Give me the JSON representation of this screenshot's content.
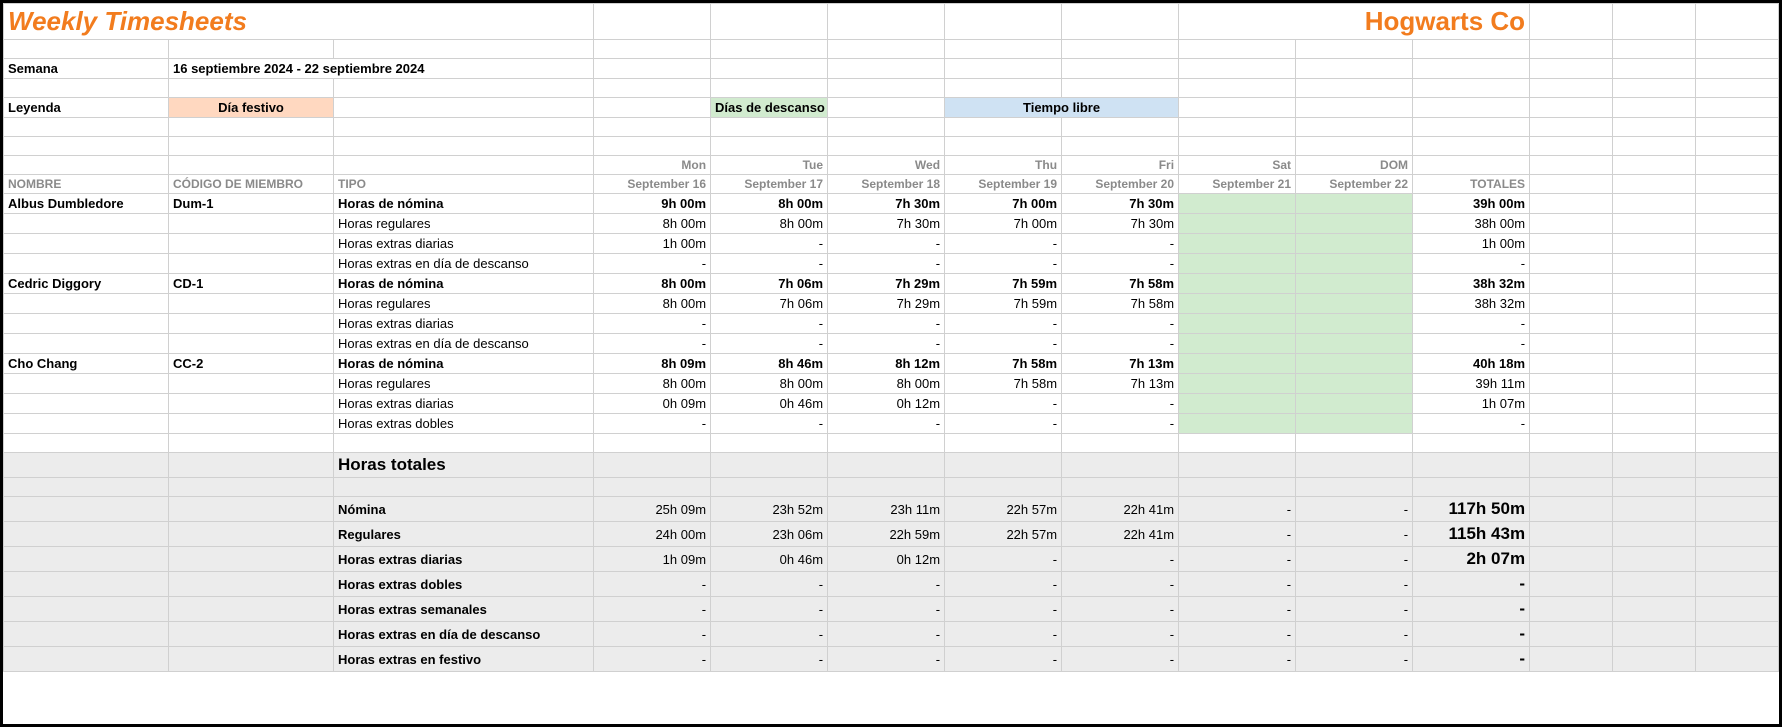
{
  "title": "Weekly Timesheets",
  "company": "Hogwarts Co",
  "meta": {
    "semana_label": "Semana",
    "semana_value": "16 septiembre 2024 - 22 septiembre 2024",
    "leyenda_label": "Leyenda",
    "dia_festivo": "Día festivo",
    "dias_descanso": "Días de descanso",
    "tiempo_libre": "Tiempo libre"
  },
  "headers": {
    "nombre": "NOMBRE",
    "codigo": "CÓDIGO DE MIEMBRO",
    "tipo": "TIPO",
    "totales": "TOTALES",
    "days_top": [
      "Mon",
      "Tue",
      "Wed",
      "Thu",
      "Fri",
      "Sat",
      "DOM"
    ],
    "days_bottom": [
      "September 16",
      "September 17",
      "September 18",
      "September 19",
      "September 20",
      "September 21",
      "September 22"
    ]
  },
  "employees": [
    {
      "name": "Albus Dumbledore",
      "code": "Dum-1",
      "rows": [
        {
          "label": "Horas de nómina",
          "bold": true,
          "vals": [
            "9h 00m",
            "8h 00m",
            "7h 30m",
            "7h 00m",
            "7h 30m",
            "",
            ""
          ],
          "total": "39h 00m",
          "greenWeekend": true
        },
        {
          "label": "Horas regulares",
          "bold": false,
          "vals": [
            "8h 00m",
            "8h 00m",
            "7h 30m",
            "7h 00m",
            "7h 30m",
            "",
            ""
          ],
          "total": "38h 00m",
          "greenWeekend": true
        },
        {
          "label": "Horas extras diarias",
          "bold": false,
          "vals": [
            "1h 00m",
            "-",
            "-",
            "-",
            "-",
            "",
            ""
          ],
          "total": "1h 00m",
          "greenWeekend": true
        },
        {
          "label": "Horas extras en día de descanso",
          "bold": false,
          "vals": [
            "-",
            "-",
            "-",
            "-",
            "-",
            "",
            ""
          ],
          "total": "-",
          "greenWeekend": true
        }
      ]
    },
    {
      "name": "Cedric Diggory",
      "code": "CD-1",
      "rows": [
        {
          "label": "Horas de nómina",
          "bold": true,
          "vals": [
            "8h 00m",
            "7h 06m",
            "7h 29m",
            "7h 59m",
            "7h 58m",
            "",
            ""
          ],
          "total": "38h 32m",
          "greenWeekend": true
        },
        {
          "label": "Horas regulares",
          "bold": false,
          "vals": [
            "8h 00m",
            "7h 06m",
            "7h 29m",
            "7h 59m",
            "7h 58m",
            "",
            ""
          ],
          "total": "38h 32m",
          "greenWeekend": true
        },
        {
          "label": "Horas extras diarias",
          "bold": false,
          "vals": [
            "-",
            "-",
            "-",
            "-",
            "-",
            "",
            ""
          ],
          "total": "-",
          "greenWeekend": true
        },
        {
          "label": "Horas extras en día de descanso",
          "bold": false,
          "vals": [
            "-",
            "-",
            "-",
            "-",
            "-",
            "",
            ""
          ],
          "total": "-",
          "greenWeekend": true
        }
      ]
    },
    {
      "name": "Cho Chang",
      "code": "CC-2",
      "rows": [
        {
          "label": "Horas de nómina",
          "bold": true,
          "vals": [
            "8h 09m",
            "8h 46m",
            "8h 12m",
            "7h 58m",
            "7h 13m",
            "",
            ""
          ],
          "total": "40h 18m",
          "greenWeekend": true
        },
        {
          "label": "Horas regulares",
          "bold": false,
          "vals": [
            "8h 00m",
            "8h 00m",
            "8h 00m",
            "7h 58m",
            "7h 13m",
            "",
            ""
          ],
          "total": "39h 11m",
          "greenWeekend": true
        },
        {
          "label": "Horas extras diarias",
          "bold": false,
          "vals": [
            "0h 09m",
            "0h 46m",
            "0h 12m",
            "-",
            "-",
            "",
            ""
          ],
          "total": "1h 07m",
          "greenWeekend": true
        },
        {
          "label": "Horas extras dobles",
          "bold": false,
          "vals": [
            "-",
            "-",
            "-",
            "-",
            "-",
            "",
            ""
          ],
          "total": "-",
          "greenWeekend": true
        }
      ]
    }
  ],
  "totals": {
    "heading": "Horas totales",
    "rows": [
      {
        "label": "Nómina",
        "vals": [
          "25h 09m",
          "23h 52m",
          "23h 11m",
          "22h 57m",
          "22h 41m",
          "-",
          "-"
        ],
        "total": "117h 50m",
        "big": true
      },
      {
        "label": "Regulares",
        "vals": [
          "24h 00m",
          "23h 06m",
          "22h 59m",
          "22h 57m",
          "22h 41m",
          "-",
          "-"
        ],
        "total": "115h 43m",
        "big": true
      },
      {
        "label": "Horas extras diarias",
        "vals": [
          "1h 09m",
          "0h 46m",
          "0h 12m",
          "-",
          "-",
          "-",
          "-"
        ],
        "total": "2h 07m",
        "big": true
      },
      {
        "label": "Horas extras dobles",
        "vals": [
          "-",
          "-",
          "-",
          "-",
          "-",
          "-",
          "-"
        ],
        "total": "-",
        "big": true
      },
      {
        "label": "Horas extras semanales",
        "vals": [
          "-",
          "-",
          "-",
          "-",
          "-",
          "-",
          "-"
        ],
        "total": "-",
        "big": true
      },
      {
        "label": "Horas extras en día de descanso",
        "vals": [
          "-",
          "-",
          "-",
          "-",
          "-",
          "-",
          "-"
        ],
        "total": "-",
        "big": true
      },
      {
        "label": "Horas extras en festivo",
        "vals": [
          "-",
          "-",
          "-",
          "-",
          "-",
          "-",
          "-"
        ],
        "total": "-",
        "big": true
      }
    ]
  }
}
